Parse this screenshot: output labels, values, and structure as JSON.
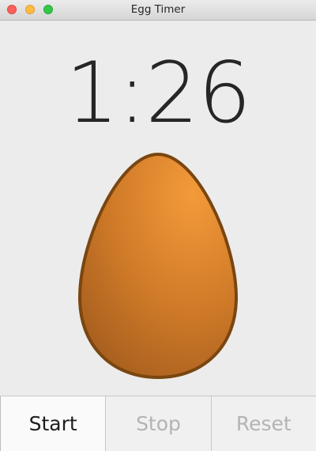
{
  "window": {
    "title": "Egg Timer"
  },
  "timer": {
    "display": "1:26"
  },
  "egg": {
    "icon": "egg-icon",
    "fill_light": "#f0973a",
    "fill_dark": "#a9611e",
    "outline": "#7a4610"
  },
  "controls": {
    "start_label": "Start",
    "stop_label": "Stop",
    "reset_label": "Reset"
  },
  "colors": {
    "close": "#fc605c",
    "minimize": "#fdbc40",
    "maximize": "#34c84a"
  }
}
